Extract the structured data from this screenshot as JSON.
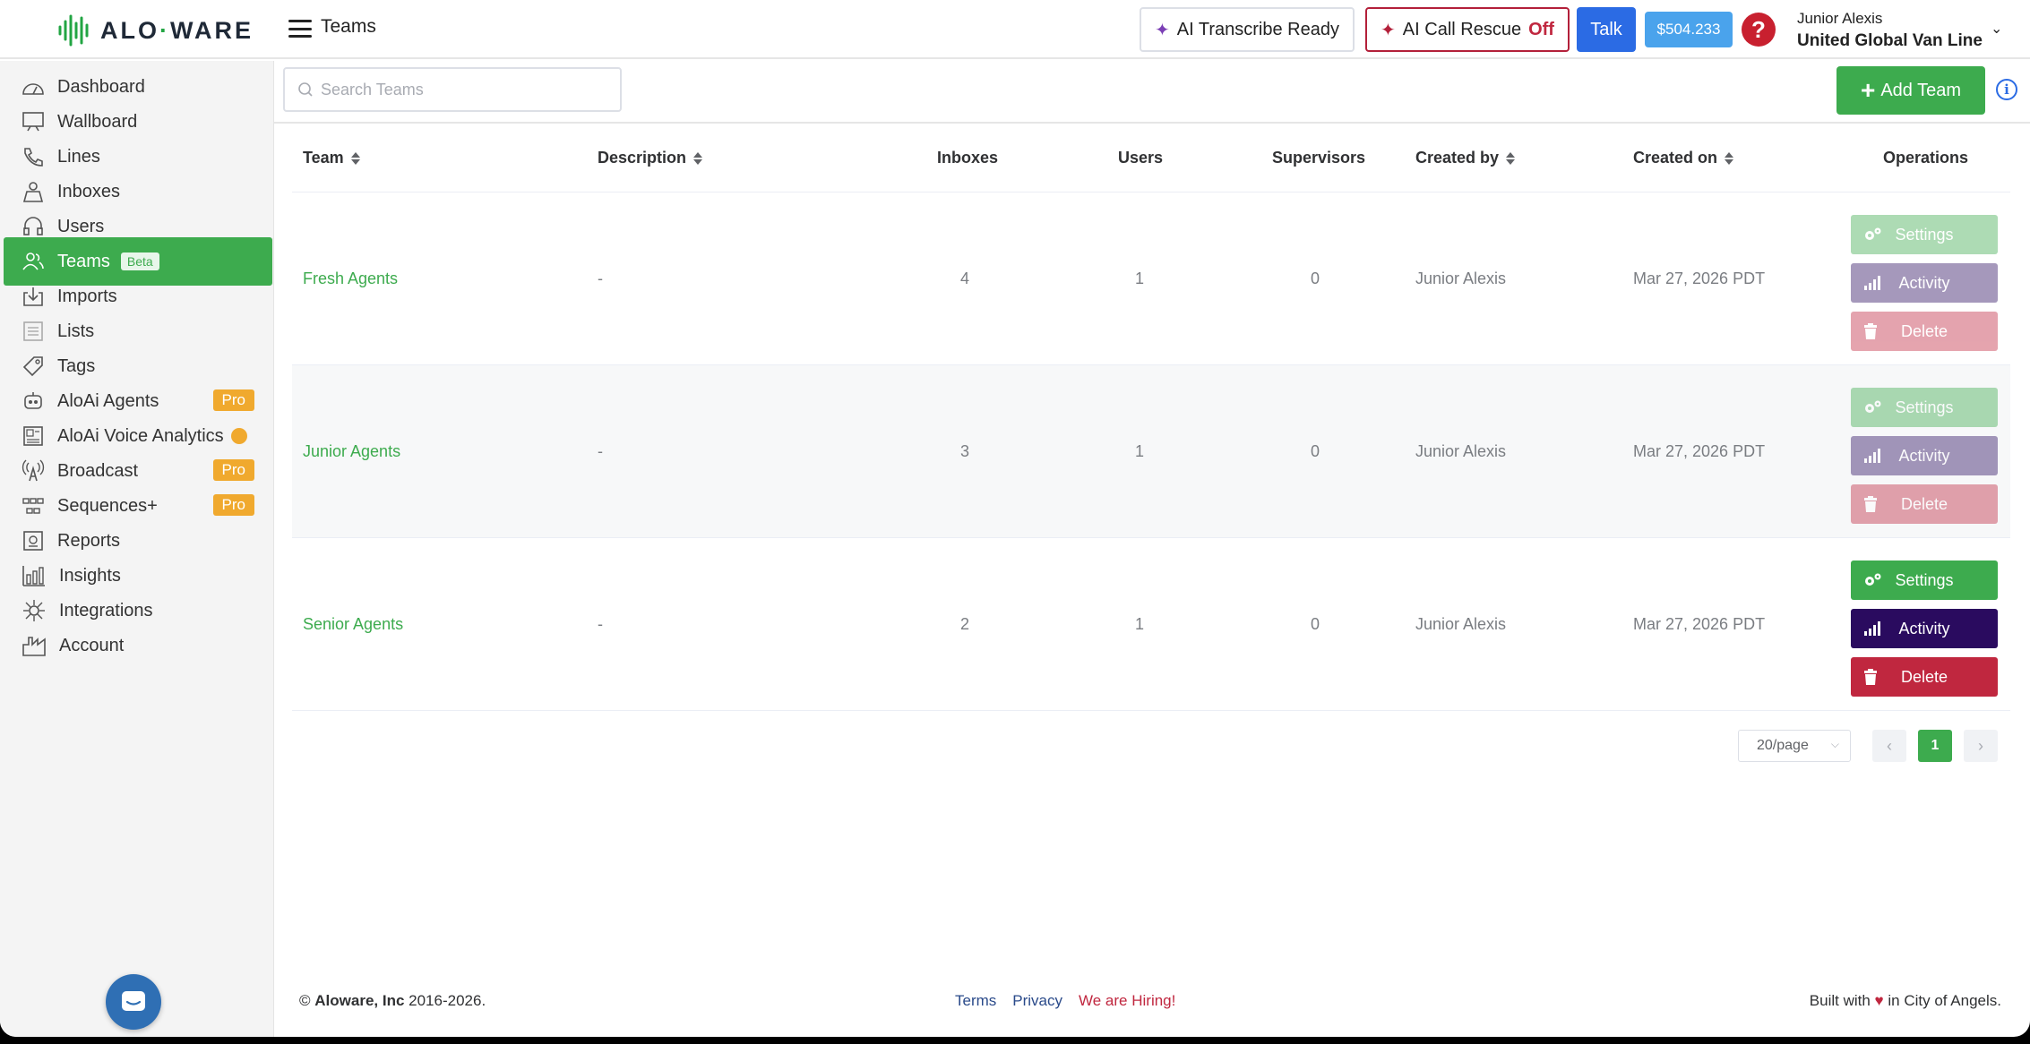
{
  "header": {
    "logo_left": "ALO",
    "logo_right": "WARE",
    "page_title": "Teams",
    "transcribe_label": "AI Transcribe Ready",
    "rescue_label": "AI Call Rescue",
    "rescue_state": "Off",
    "talk_label": "Talk",
    "balance": "$504.233",
    "help_glyph": "?",
    "user_name": "Junior Alexis",
    "company": "United Global Van Line"
  },
  "sidebar": {
    "items": [
      {
        "label": "Dashboard",
        "icon": "dashboard-icon"
      },
      {
        "label": "Wallboard",
        "icon": "wallboard-icon"
      },
      {
        "label": "Lines",
        "icon": "phone-icon"
      },
      {
        "label": "Inboxes",
        "icon": "inbox-icon"
      },
      {
        "label": "Users",
        "icon": "headset-icon"
      },
      {
        "label": "Teams",
        "icon": "team-icon",
        "badge": "Beta"
      },
      {
        "label": "Imports",
        "icon": "import-icon"
      },
      {
        "label": "Lists",
        "icon": "list-icon"
      },
      {
        "label": "Tags",
        "icon": "tag-icon"
      },
      {
        "label": "AloAi Agents",
        "icon": "robot-icon",
        "badge": "Pro"
      },
      {
        "label": "AloAi Voice Analytics",
        "icon": "analytics-icon"
      },
      {
        "label": "Broadcast",
        "icon": "broadcast-icon",
        "badge": "Pro"
      },
      {
        "label": "Sequences+",
        "icon": "sequences-icon",
        "badge": "Pro"
      },
      {
        "label": "Reports",
        "icon": "reports-icon"
      },
      {
        "label": "Insights",
        "icon": "insights-icon"
      },
      {
        "label": "Integrations",
        "icon": "integrations-icon"
      },
      {
        "label": "Account",
        "icon": "account-icon"
      }
    ]
  },
  "toolbar": {
    "search_placeholder": "Search Teams",
    "add_label": "Add Team",
    "info_glyph": "i"
  },
  "table": {
    "columns": [
      "Team",
      "Description",
      "Inboxes",
      "Users",
      "Supervisors",
      "Created by",
      "Created on",
      "Operations"
    ],
    "rows": [
      {
        "team": "Fresh Agents",
        "description": "-",
        "inboxes": "4",
        "users": "1",
        "supervisors": "0",
        "created_by": "Junior Alexis",
        "created_on": "Mar 27, 2026 PDT"
      },
      {
        "team": "Junior Agents",
        "description": "-",
        "inboxes": "3",
        "users": "1",
        "supervisors": "0",
        "created_by": "Junior Alexis",
        "created_on": "Mar 27, 2026 PDT"
      },
      {
        "team": "Senior Agents",
        "description": "-",
        "inboxes": "2",
        "users": "1",
        "supervisors": "0",
        "created_by": "Junior Alexis",
        "created_on": "Mar 27, 2026 PDT"
      }
    ],
    "ops": {
      "settings": "Settings",
      "activity": "Activity",
      "delete": "Delete"
    }
  },
  "pagination": {
    "page_size": "20/page",
    "current_page": "1",
    "prev": "‹",
    "next": "›"
  },
  "footer": {
    "copyright_symbol": "©",
    "company": "Aloware, Inc",
    "years": "2016-2026.",
    "terms": "Terms",
    "privacy": "Privacy",
    "hiring": "We are Hiring!",
    "built_prefix": "Built with",
    "built_suffix": "in City of Angels."
  },
  "colors": {
    "brand_green": "#3dab4e",
    "activity_purple": "#2a0b5f",
    "delete_red": "#c0273f",
    "talk_blue": "#2b6be4",
    "pro_orange": "#f0a92e"
  }
}
